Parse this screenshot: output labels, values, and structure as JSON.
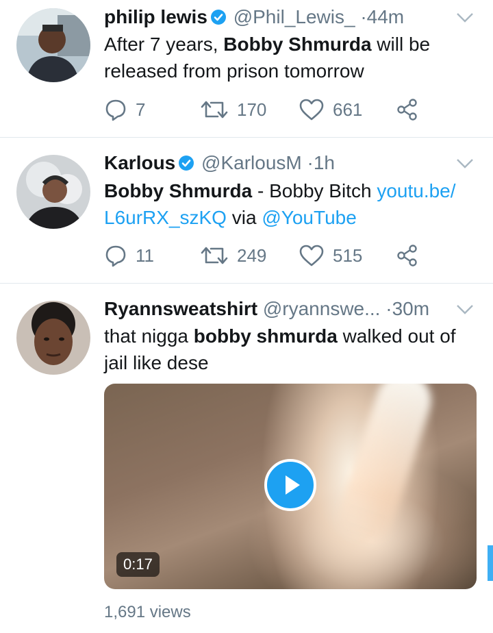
{
  "colors": {
    "accent": "#1da1f2",
    "secondary_text": "#657786",
    "divider": "#e1e8ed"
  },
  "tweets": [
    {
      "name": "philip lewis",
      "handle": "@Phil_Lewis_",
      "separator": "·",
      "time": "44m",
      "verified": true,
      "text_parts": [
        "After 7 years, ",
        "Bobby Shmurda",
        " will be released from prison tomorrow"
      ],
      "replies": "7",
      "retweets": "170",
      "likes": "661"
    },
    {
      "name": "Karlous",
      "handle": "@KarlousM",
      "separator": "·",
      "time": "1h",
      "verified": true,
      "text_parts": [
        "Bobby Shmurda",
        " - Bobby Bitch ",
        "youtu.be/ L6urRX_szKQ",
        " via ",
        "@YouTube"
      ],
      "replies": "11",
      "retweets": "249",
      "likes": "515"
    },
    {
      "name": "Ryannsweatshirt",
      "handle": "@ryannswe...",
      "separator": "·",
      "time": "30m",
      "verified": false,
      "text_parts": [
        "that nigga ",
        "bobby shmurda",
        " walked out of jail like dese"
      ],
      "video": {
        "duration": "0:17",
        "views": "1,691 views",
        "play_icon": "play-icon"
      }
    }
  ],
  "icons": [
    "reply-icon",
    "retweet-icon",
    "like-icon",
    "share-icon",
    "chevron-down-icon",
    "verified-badge-icon"
  ]
}
